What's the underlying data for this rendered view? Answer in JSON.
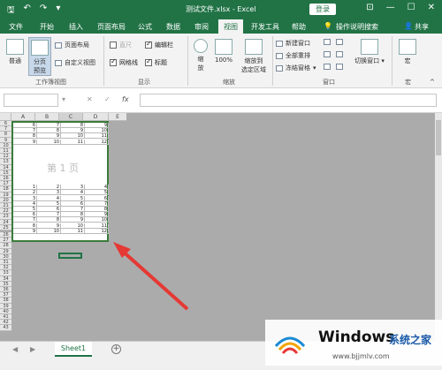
{
  "titlebar": {
    "title": "测试文件.xlsx - Excel",
    "login_label": "登录",
    "save_icon": "save-icon",
    "undo_icon": "undo-icon",
    "redo_icon": "redo-icon",
    "minimize": "—",
    "restore": "☐",
    "close": "✕",
    "bg_color": "#217346"
  },
  "menu": {
    "tabs": [
      "文件",
      "开始",
      "插入",
      "页面布局",
      "公式",
      "数据",
      "审阅",
      "视图",
      "开发工具",
      "帮助"
    ],
    "active_tab": "视图",
    "search_label": "操作说明搜索",
    "share_label": "共享"
  },
  "ribbon": {
    "workbook_views": {
      "normal": "普通",
      "page_break": "分页\n预览",
      "page_layout": "页面布局",
      "custom_view": "自定义视图",
      "group_label": "工作簿视图"
    },
    "show": {
      "ruler": "直尺",
      "formula_bar": "编辑栏",
      "gridlines": "网格线",
      "headings": "标题",
      "group_label": "显示"
    },
    "zoom": {
      "zoom": "缩\n放",
      "zoom100": "100%",
      "zoom_selection": "缩放到\n选定区域",
      "group_label": "缩放"
    },
    "window": {
      "new_window": "新建窗口",
      "arrange_all": "全部重排",
      "freeze_panes": "冻结窗格",
      "switch_windows": "切换窗口",
      "group_label": "窗口"
    },
    "macros": {
      "macros": "宏",
      "group_label": "宏"
    }
  },
  "formula_bar": {
    "cancel": "✕",
    "enter": "✓",
    "fx": "fx",
    "name_value": "",
    "formula_value": ""
  },
  "sheet": {
    "columns": [
      "A",
      "B",
      "C",
      "D",
      "E"
    ],
    "page_label": "第 1 页",
    "top_rows": [
      {
        "row": "6",
        "values": [
          "6",
          "7",
          "8",
          "9"
        ]
      },
      {
        "row": "7",
        "values": [
          "7",
          "8",
          "9",
          "10"
        ]
      },
      {
        "row": "8",
        "values": [
          "8",
          "9",
          "10",
          "11"
        ]
      },
      {
        "row": "9",
        "values": [
          "9",
          "10",
          "11",
          "12"
        ]
      }
    ],
    "bottom_rows": [
      {
        "row": "17",
        "values": [
          "1",
          "2",
          "3",
          "4"
        ]
      },
      {
        "row": "18",
        "values": [
          "2",
          "3",
          "4",
          "5"
        ]
      },
      {
        "row": "19",
        "values": [
          "3",
          "4",
          "5",
          "6"
        ]
      },
      {
        "row": "20",
        "values": [
          "4",
          "5",
          "6",
          "7"
        ]
      },
      {
        "row": "21",
        "values": [
          "5",
          "6",
          "7",
          "8"
        ]
      },
      {
        "row": "22",
        "values": [
          "6",
          "7",
          "8",
          "9"
        ]
      },
      {
        "row": "23",
        "values": [
          "7",
          "8",
          "9",
          "10"
        ]
      },
      {
        "row": "24",
        "values": [
          "8",
          "9",
          "10",
          "11"
        ]
      },
      {
        "row": "25",
        "values": [
          "9",
          "10",
          "11",
          "12"
        ]
      }
    ],
    "extra_rows": [
      "10",
      "11",
      "12",
      "13",
      "14",
      "15",
      "16",
      "26",
      "27",
      "28",
      "29",
      "30",
      "31",
      "32",
      "33",
      "34",
      "35",
      "36",
      "37",
      "38",
      "39",
      "40",
      "41",
      "42",
      "43"
    ],
    "page_border_color": "#3a7c3a",
    "annotation_color": "#e53935"
  },
  "sheet_tabs": {
    "tabs": [
      "Sheet1"
    ],
    "add_label": "+",
    "prev": "◀",
    "next": "▶"
  },
  "watermark": {
    "title": "Windows",
    "subtitle": "系统之家",
    "url": "www.bjjmlv.com"
  }
}
